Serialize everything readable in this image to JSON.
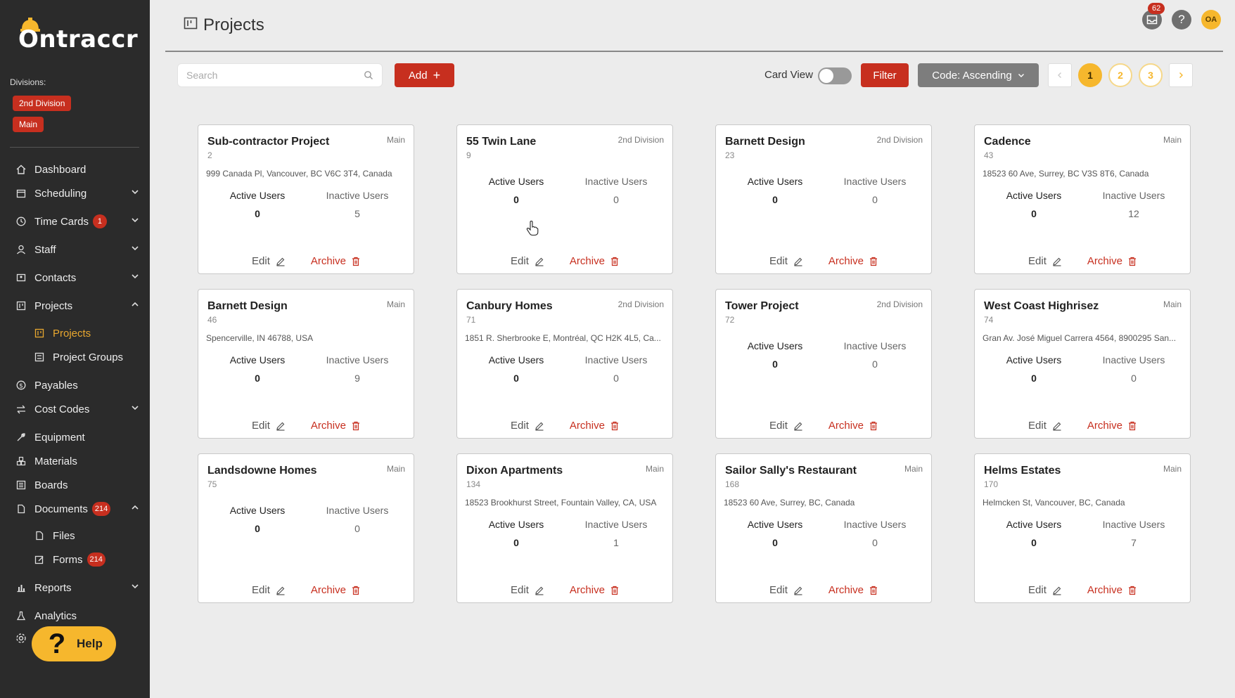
{
  "app": {
    "logo_text": "Ontraccr",
    "brand_color": "#c72f1f",
    "accent_color": "#f6b72d"
  },
  "sidebar": {
    "divisions_label": "Divisions:",
    "divisions": [
      "2nd Division",
      "Main"
    ],
    "nav": {
      "dashboard": "Dashboard",
      "scheduling": "Scheduling",
      "time_cards": "Time Cards",
      "time_cards_count": "1",
      "staff": "Staff",
      "contacts": "Contacts",
      "projects": "Projects",
      "projects_sub": "Projects",
      "project_groups": "Project Groups",
      "payables": "Payables",
      "cost_codes": "Cost Codes",
      "equipment": "Equipment",
      "materials": "Materials",
      "boards": "Boards",
      "documents": "Documents",
      "documents_count": "214",
      "files": "Files",
      "forms": "Forms",
      "forms_count": "214",
      "reports": "Reports",
      "analytics": "Analytics"
    },
    "help_label": "Help"
  },
  "header": {
    "title": "Projects",
    "notifications_count": "62",
    "help_icon": "?",
    "avatar_initials": "OA"
  },
  "toolbar": {
    "search_placeholder": "Search",
    "add_label": "Add",
    "card_view_label": "Card View",
    "filter_label": "Filter",
    "sort_label": "Code: Ascending",
    "pages": [
      "1",
      "2",
      "3"
    ],
    "current_page": "1"
  },
  "labels": {
    "active_users": "Active Users",
    "inactive_users": "Inactive Users",
    "edit": "Edit",
    "archive": "Archive"
  },
  "projects": [
    {
      "name": "Sub-contractor Project",
      "division": "Main",
      "code": "2",
      "address": "999 Canada Pl, Vancouver, BC V6C 3T4, Canada",
      "active": "0",
      "inactive": "5"
    },
    {
      "name": "55 Twin Lane",
      "division": "2nd Division",
      "code": "9",
      "address": "",
      "active": "0",
      "inactive": "0"
    },
    {
      "name": "Barnett Design",
      "division": "2nd Division",
      "code": "23",
      "address": "",
      "active": "0",
      "inactive": "0"
    },
    {
      "name": "Cadence",
      "division": "Main",
      "code": "43",
      "address": "18523 60 Ave, Surrey, BC V3S 8T6, Canada",
      "active": "0",
      "inactive": "12"
    },
    {
      "name": "Barnett Design",
      "division": "Main",
      "code": "46",
      "address": "Spencerville, IN 46788, USA",
      "active": "0",
      "inactive": "9"
    },
    {
      "name": "Canbury Homes",
      "division": "2nd Division",
      "code": "71",
      "address": "1851 R. Sherbrooke E, Montréal, QC H2K 4L5, Ca...",
      "active": "0",
      "inactive": "0"
    },
    {
      "name": "Tower Project",
      "division": "2nd Division",
      "code": "72",
      "address": "",
      "active": "0",
      "inactive": "0"
    },
    {
      "name": "West Coast Highrisez",
      "division": "Main",
      "code": "74",
      "address": "Gran Av. José Miguel Carrera 4564, 8900295 San...",
      "active": "0",
      "inactive": "0"
    },
    {
      "name": "Landsdowne Homes",
      "division": "Main",
      "code": "75",
      "address": "",
      "active": "0",
      "inactive": "0"
    },
    {
      "name": "Dixon Apartments",
      "division": "Main",
      "code": "134",
      "address": "18523 Brookhurst Street, Fountain Valley, CA, USA",
      "active": "0",
      "inactive": "1"
    },
    {
      "name": "Sailor Sally's Restaurant",
      "division": "Main",
      "code": "168",
      "address": "18523 60 Ave, Surrey, BC, Canada",
      "active": "0",
      "inactive": "0"
    },
    {
      "name": "Helms Estates",
      "division": "Main",
      "code": "170",
      "address": "Helmcken St, Vancouver, BC, Canada",
      "active": "0",
      "inactive": "7"
    }
  ]
}
